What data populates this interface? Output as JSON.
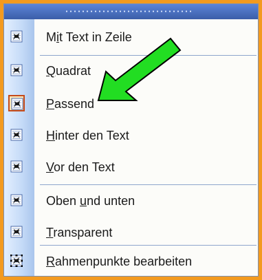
{
  "menu": {
    "items": [
      {
        "label": "Mit Text in Zeile",
        "accel_index": 1,
        "icon": "inline-with-text-icon",
        "checked": false
      },
      {
        "label": "Quadrat",
        "accel_index": 0,
        "icon": "square-wrap-icon",
        "checked": false
      },
      {
        "label": "Passend",
        "accel_index": 0,
        "icon": "tight-wrap-icon",
        "checked": true
      },
      {
        "label": "Hinter den Text",
        "accel_index": 0,
        "icon": "behind-text-icon",
        "checked": false
      },
      {
        "label": "Vor den Text",
        "accel_index": 0,
        "icon": "in-front-of-text-icon",
        "checked": false
      },
      {
        "label": "Oben und unten",
        "accel_index": 5,
        "icon": "top-and-bottom-icon",
        "checked": false
      },
      {
        "label": "Transparent",
        "accel_index": 0,
        "icon": "through-wrap-icon",
        "checked": false
      },
      {
        "label": "Rahmenpunkte bearbeiten",
        "accel_index": 0,
        "icon": "edit-wrap-points-icon",
        "checked": false
      }
    ]
  },
  "colors": {
    "frame": "#f39a1f",
    "grip": "#3b5ea8",
    "arrow_fill": "#22dd22",
    "checked_border": "#c44a1a"
  }
}
